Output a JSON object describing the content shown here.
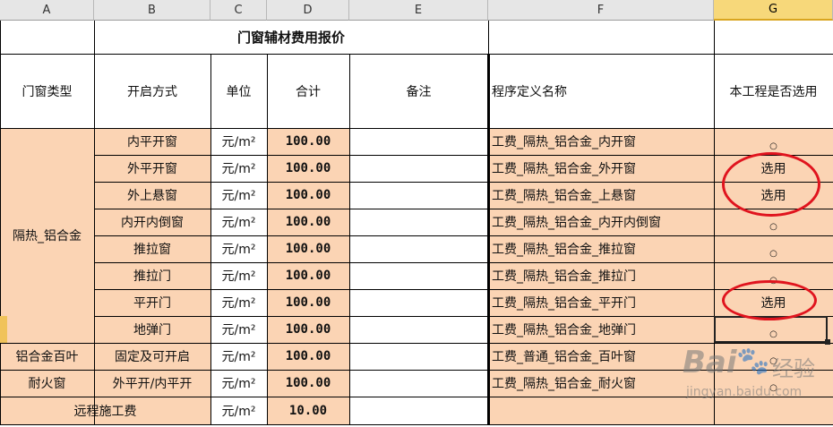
{
  "columns": [
    "A",
    "B",
    "C",
    "D",
    "E",
    "F",
    "G"
  ],
  "selected_column": "G",
  "title": "门窗辅材费用报价",
  "headers": {
    "type": "门窗类型",
    "opening": "开启方式",
    "unit": "单位",
    "total": "合计",
    "note": "备注",
    "program_name": "程序定义名称",
    "selected": "本工程是否选用"
  },
  "groups": [
    {
      "label": "隔热_铝合金"
    },
    {
      "label": "铝合金百叶"
    },
    {
      "label": "耐火窗"
    }
  ],
  "rows": [
    {
      "opening": "内平开窗",
      "unit": "元/m²",
      "total": "100.00",
      "program": "工费_隔热_铝合金_内开窗",
      "sel": "○"
    },
    {
      "opening": "外平开窗",
      "unit": "元/m²",
      "total": "100.00",
      "program": "工费_隔热_铝合金_外开窗",
      "sel": "选用"
    },
    {
      "opening": "外上悬窗",
      "unit": "元/m²",
      "total": "100.00",
      "program": "工费_隔热_铝合金_上悬窗",
      "sel": "选用"
    },
    {
      "opening": "内开内倒窗",
      "unit": "元/m²",
      "total": "100.00",
      "program": "工费_隔热_铝合金_内开内倒窗",
      "sel": "○"
    },
    {
      "opening": "推拉窗",
      "unit": "元/m²",
      "total": "100.00",
      "program": "工费_隔热_铝合金_推拉窗",
      "sel": "○"
    },
    {
      "opening": "推拉门",
      "unit": "元/m²",
      "total": "100.00",
      "program": "工费_隔热_铝合金_推拉门",
      "sel": "○"
    },
    {
      "opening": "平开门",
      "unit": "元/m²",
      "total": "100.00",
      "program": "工费_隔热_铝合金_平开门",
      "sel": "选用"
    },
    {
      "opening": "地弹门",
      "unit": "元/m²",
      "total": "100.00",
      "program": "工费_隔热_铝合金_地弹门",
      "sel": "○"
    },
    {
      "opening": "固定及可开启",
      "unit": "元/m²",
      "total": "100.00",
      "program": "工费_普通_铝合金_百叶窗",
      "sel": "○"
    },
    {
      "opening": "外平开/内平开",
      "unit": "元/m²",
      "total": "100.00",
      "program": "工费_隔热_铝合金_耐火窗",
      "sel": "○"
    }
  ],
  "footer": {
    "label": "远程施工费",
    "unit": "元/m²",
    "total": "10.00"
  },
  "watermark": {
    "brand": "Bai",
    "brand2": "经验",
    "url": "jingyan.baidu.com"
  },
  "colors": {
    "peach": "#fbd4b4",
    "annotation": "#e0141e",
    "selected_col": "#f7d87a"
  }
}
